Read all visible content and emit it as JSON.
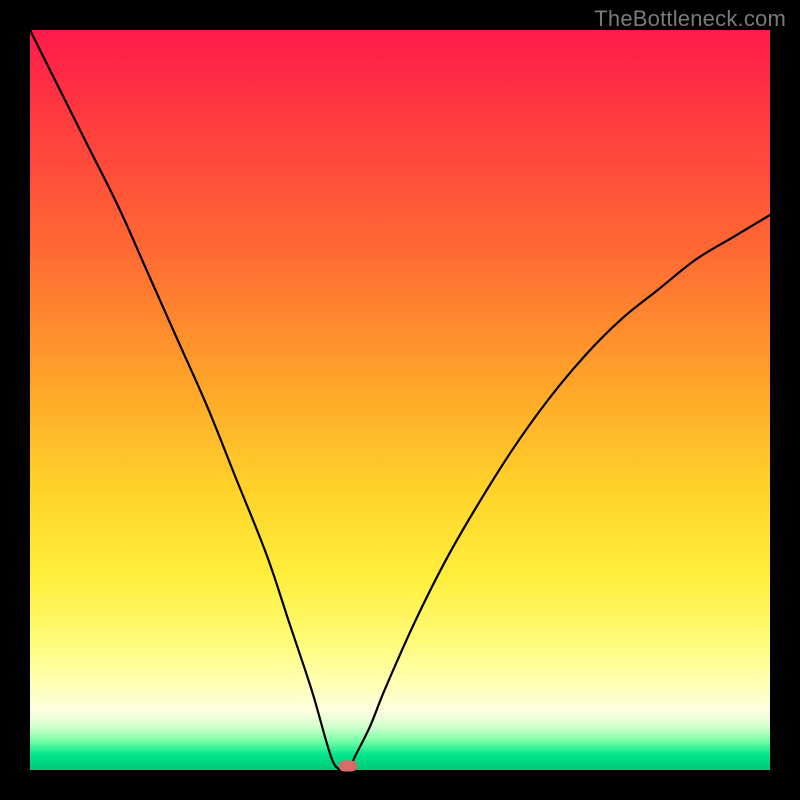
{
  "watermark": "TheBottleneck.com",
  "colors": {
    "frame": "#000000",
    "gradient_top": "#ff1a4b",
    "gradient_bottom": "#00c97a",
    "curve": "#000000",
    "marker": "#d96a6a",
    "watermark_text": "#7a7a7a"
  },
  "chart_data": {
    "type": "line",
    "title": "",
    "xlabel": "",
    "ylabel": "",
    "xlim": [
      0,
      100
    ],
    "ylim": [
      0,
      100
    ],
    "grid": false,
    "legend": false,
    "minimum": {
      "x": 42,
      "y": 0
    },
    "marker": {
      "x": 43,
      "y": 0.5
    },
    "series": [
      {
        "name": "bottleneck-curve",
        "x": [
          0,
          4,
          8,
          12,
          16,
          20,
          24,
          28,
          32,
          35,
          38,
          40,
          41,
          42,
          43,
          44,
          46,
          48,
          52,
          56,
          60,
          65,
          70,
          75,
          80,
          85,
          90,
          95,
          100
        ],
        "y": [
          100,
          92,
          84,
          76,
          67,
          58,
          49,
          39,
          29,
          20,
          11,
          4,
          1,
          0,
          0,
          2,
          6,
          11,
          20,
          28,
          35,
          43,
          50,
          56,
          61,
          65,
          69,
          72,
          75
        ]
      }
    ]
  }
}
